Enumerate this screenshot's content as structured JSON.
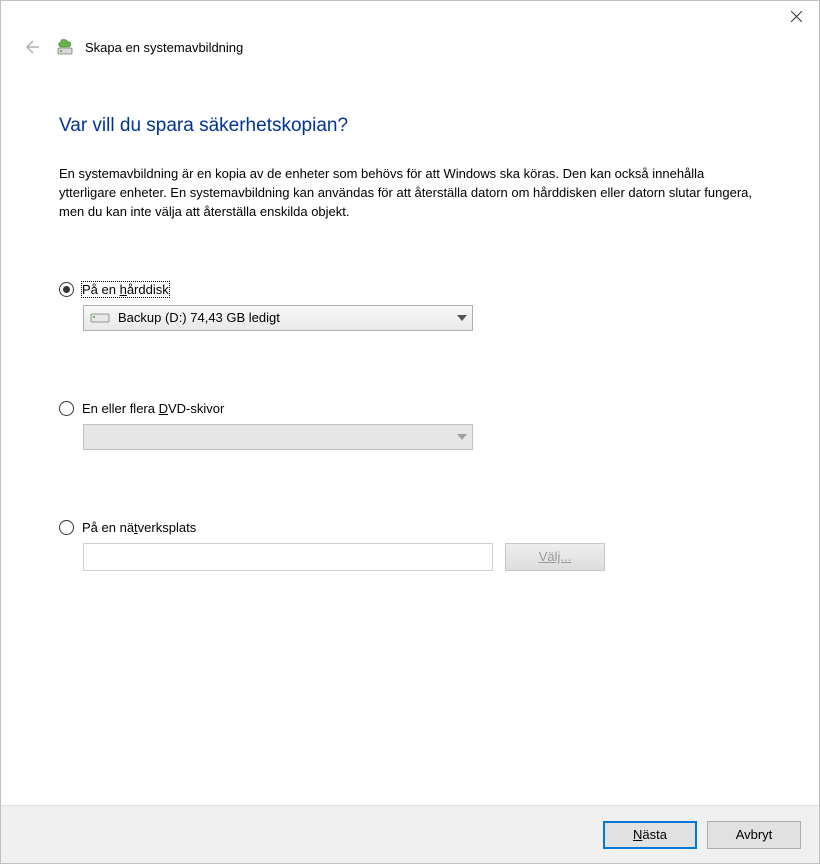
{
  "window": {
    "app_title": "Skapa en systemavbildning"
  },
  "content": {
    "heading": "Var vill du spara säkerhetskopian?",
    "description": "En systemavbildning är en kopia av de enheter som behövs för att Windows ska köras. Den kan också innehålla ytterligare enheter. En systemavbildning kan användas för att återställa datorn om hårddisken eller datorn slutar fungera, men du kan inte välja att återställa enskilda objekt."
  },
  "options": {
    "harddisk": {
      "label_pre": "På en ",
      "label_accel": "h",
      "label_post": "årddisk",
      "selected": true,
      "dropdown_value": "Backup (D:)  74,43 GB ledigt"
    },
    "dvd": {
      "label_pre": "En eller flera ",
      "label_accel": "D",
      "label_post": "VD-skivor",
      "selected": false,
      "dropdown_value": ""
    },
    "network": {
      "label_pre": "På en nä",
      "label_accel": "t",
      "label_post": "verksplats",
      "selected": false,
      "input_value": "",
      "browse_label_accel": "V",
      "browse_label_post": "älj..."
    }
  },
  "footer": {
    "next_accel": "N",
    "next_post": "ästa",
    "cancel": "Avbryt"
  }
}
